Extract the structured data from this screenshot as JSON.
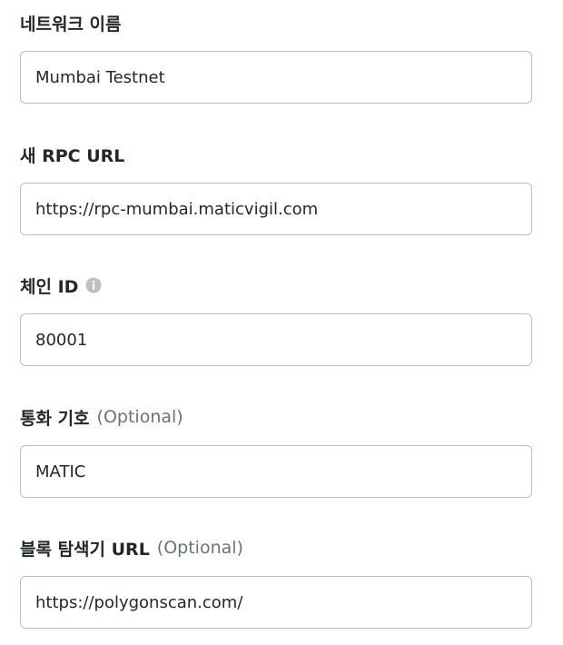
{
  "form": {
    "fields": [
      {
        "label": "네트워크 이름",
        "optional": "",
        "value": "Mumbai Testnet"
      },
      {
        "label": "새 RPC URL",
        "optional": "",
        "value": "https://rpc-mumbai.maticvigil.com"
      },
      {
        "label": "체인 ID",
        "optional": "",
        "value": "80001",
        "icon": "info-icon"
      },
      {
        "label": "통화 기호",
        "optional": "(Optional)",
        "value": "MATIC"
      },
      {
        "label": "블록 탐색기 URL",
        "optional": "(Optional)",
        "value": "https://polygonscan.com/"
      }
    ]
  },
  "colors": {
    "label": "#24272a",
    "optional": "#6a737d",
    "border": "#bbc0c5",
    "icon": "#bbc0c5"
  }
}
